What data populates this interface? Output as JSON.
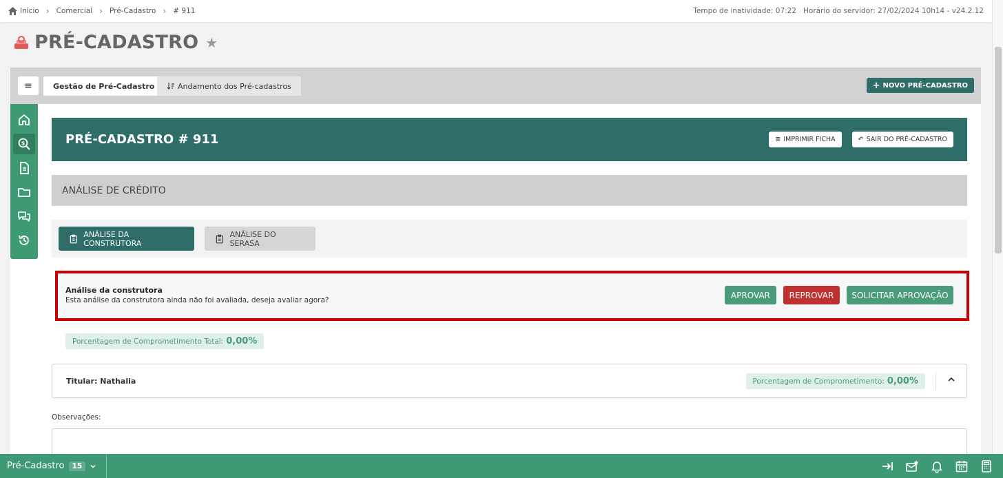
{
  "breadcrumb": {
    "items": [
      "Início",
      "Comercial",
      "Pré-Cadastro",
      "# 911"
    ]
  },
  "server": {
    "idle_time": "Tempo de inatividade: 07:22",
    "server_time": "Horário do servidor: 27/02/2024 10h14 - v24.2.12"
  },
  "page": {
    "title": "PRÉ-CADASTRO"
  },
  "tabs": {
    "menu_glyph": "≡",
    "items": [
      {
        "label": "Gestão de Pré-Cadastro",
        "active": true
      },
      {
        "label": "Andamento dos Pré-cadastros",
        "active": false
      }
    ],
    "new_button": "NOVO PRÉ-CADASTRO"
  },
  "banner": {
    "title": "PRÉ-CADASTRO # 911",
    "print_label": "IMPRIMIR FICHA",
    "exit_label": "SAIR DO PRÉ-CADASTRO"
  },
  "section": {
    "title": "ANÁLISE DE CRÉDITO"
  },
  "subtabs": [
    {
      "label": "ANÁLISE DA CONSTRUTORA",
      "active": true
    },
    {
      "label": "ANÁLISE DO SERASA",
      "active": false
    }
  ],
  "analysis": {
    "title": "Análise da construtora",
    "message": "Esta análise da construtora ainda não foi avaliada, deseja avaliar agora?",
    "approve_label": "APROVAR",
    "reject_label": "REPROVAR",
    "request_label": "SOLICITAR APROVAÇÃO"
  },
  "total_commitment": {
    "label": "Porcentagem de Comprometimento Total:",
    "value": "0,00%"
  },
  "holder": {
    "name": "Titular: Nathalia",
    "pct_label": "Porcentagem de Comprometimento:",
    "pct_value": "0,00%"
  },
  "observations": {
    "label": "Observações:",
    "value": ""
  },
  "footer": {
    "module_label": "Pré-Cadastro",
    "count": "15"
  },
  "colors": {
    "primary": "#2f6e68",
    "footer_green": "#3e9a73",
    "approve": "#4a9b7a",
    "reject": "#c0302f",
    "highlight_border": "#cc0000"
  },
  "sidenav": {
    "icons": [
      "home-icon",
      "search-dollar-icon",
      "document-icon",
      "folder-icon",
      "chat-icon",
      "history-icon"
    ]
  }
}
